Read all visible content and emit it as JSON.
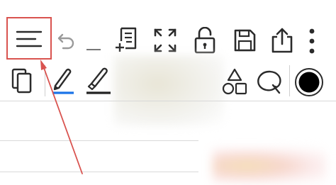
{
  "toolbar_top": {
    "items": [
      {
        "name": "menu-button",
        "icon": "hamburger-menu-icon"
      },
      {
        "name": "undo-button",
        "icon": "undo-icon"
      },
      {
        "name": "redo-button",
        "icon": "redo-placeholder-icon"
      },
      {
        "name": "add-page-button",
        "icon": "add-page-icon"
      },
      {
        "name": "fullscreen-button",
        "icon": "fullscreen-icon"
      },
      {
        "name": "lock-button",
        "icon": "unlock-icon"
      },
      {
        "name": "save-button",
        "icon": "floppy-disk-icon"
      },
      {
        "name": "share-button",
        "icon": "share-icon"
      },
      {
        "name": "more-options-button",
        "icon": "more-vertical-icon"
      }
    ]
  },
  "toolbar_tools": {
    "items": [
      {
        "name": "page-layers-button",
        "icon": "pages-icon"
      },
      {
        "name": "pen-tool",
        "icon": "pen-icon",
        "underline_color": "#1a73e8"
      },
      {
        "name": "highlighter-tool",
        "icon": "highlighter-icon",
        "underline_color": "#222222"
      },
      {
        "name": "shapes-tool",
        "icon": "shapes-icon"
      },
      {
        "name": "lasso-tool",
        "icon": "lasso-icon"
      },
      {
        "name": "color-picker",
        "icon": "color-swatch-icon",
        "selected_color": "#000000"
      }
    ]
  },
  "annotation": {
    "highlight_color": "#d9534f",
    "target": "menu-button"
  }
}
